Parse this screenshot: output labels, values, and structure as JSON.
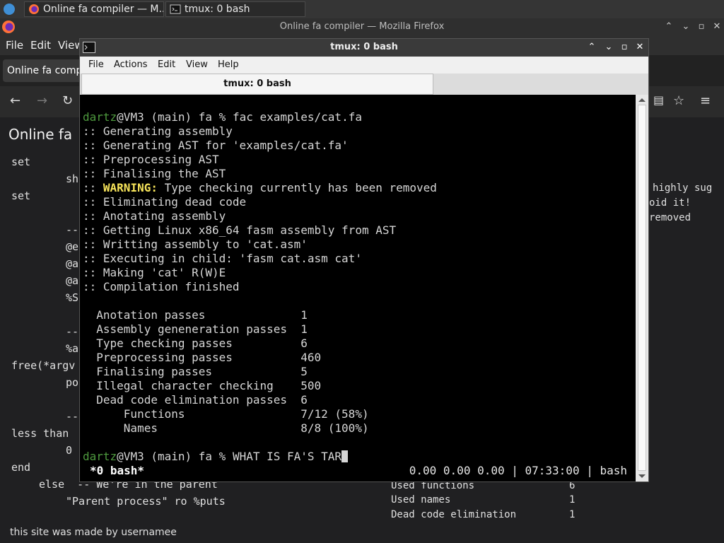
{
  "taskbar": {
    "tasks": [
      {
        "label": "Online fa compiler — M...",
        "icon": "firefox-icon"
      },
      {
        "label": "tmux: 0 bash",
        "icon": "terminal-icon"
      }
    ]
  },
  "firefox": {
    "window_title": "Online fa compiler — Mozilla Firefox",
    "menu": [
      "File",
      "Edit",
      "View"
    ],
    "tab_label": "Online fa compiler",
    "page_title": "Online fa",
    "code_lines": [
      "set",
      "sh",
      "set",
      "--",
      "@e",
      "@a",
      "@a",
      "%S",
      "--",
      "%a",
      "free(*argv",
      "po",
      "--",
      "less than",
      "0",
      "end",
      "else  -- We're in the parent",
      "\"Parent process\" ro %puts"
    ],
    "right_text": [
      "highly sug",
      "oid it!",
      "removed"
    ],
    "right_stats": [
      {
        "label": "Used functions",
        "value": "6"
      },
      {
        "label": "Used names",
        "value": "1"
      },
      {
        "label": "Dead code elimination",
        "value": "1"
      }
    ],
    "footer": "this site was made by usernamee"
  },
  "terminal": {
    "window_title": "tmux: 0 bash",
    "menu": [
      "File",
      "Actions",
      "Edit",
      "View",
      "Help"
    ],
    "tab_label": "tmux: 0 bash",
    "prompt_user": "dartz",
    "prompt_rest": "@VM3 (main) fa % ",
    "command": "fac examples/cat.fa",
    "log": [
      ":: Generating assembly",
      ":: Generating AST for 'examples/cat.fa'",
      ":: Preprocessing AST",
      ":: Finalising the AST"
    ],
    "warning_prefix": ":: ",
    "warning_label": "WARNING:",
    "warning_text": " Type checking currently has been removed",
    "log2": [
      ":: Eliminating dead code",
      ":: Anotating assembly",
      ":: Getting Linux x86_64 fasm assembly from AST",
      ":: Writting assembly to 'cat.asm'",
      ":: Executing in child: 'fasm cat.asm cat'",
      ":: Making 'cat' R(W)E",
      ":: Compilation finished"
    ],
    "stats": [
      {
        "label": "  Anotation passes              ",
        "value": "1"
      },
      {
        "label": "  Assembly geneneration passes  ",
        "value": "1"
      },
      {
        "label": "  Type checking passes          ",
        "value": "6"
      },
      {
        "label": "  Preprocessing passes          ",
        "value": "460"
      },
      {
        "label": "  Finalising passes             ",
        "value": "5"
      },
      {
        "label": "  Illegal character checking    ",
        "value": "500"
      },
      {
        "label": "  Dead code elimination passes  ",
        "value": "6"
      },
      {
        "label": "      Functions                 ",
        "value": "7/12 (58%)"
      },
      {
        "label": "      Names                     ",
        "value": "8/8 (100%)"
      }
    ],
    "typed_input": "WHAT IS FA'S TAR",
    "status_window": "*0 bash*",
    "status_right": "0.00 0.00 0.00 | 07:33:00 | bash"
  }
}
